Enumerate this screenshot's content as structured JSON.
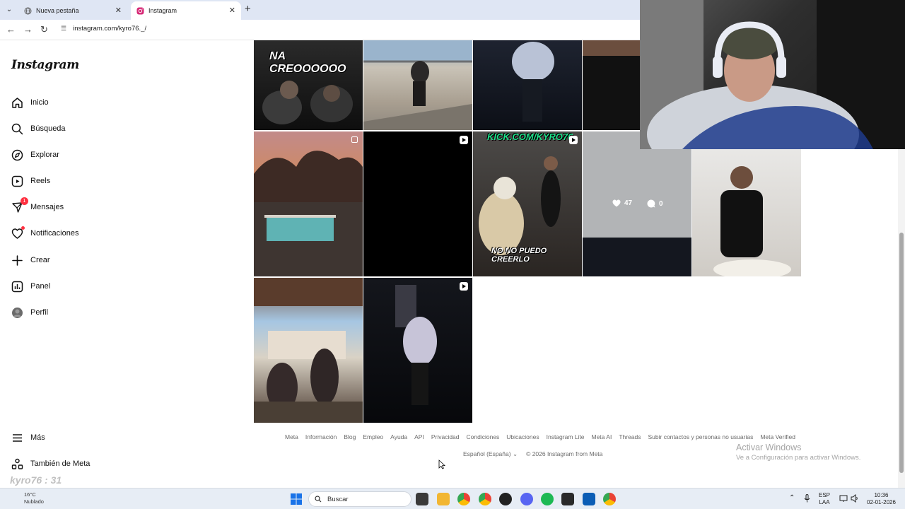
{
  "browser": {
    "tabs": [
      {
        "label": "Nueva pestaña",
        "active": false
      },
      {
        "label": "Instagram",
        "active": true
      }
    ],
    "address": "instagram.com/kyro76._/"
  },
  "sidebar": {
    "logo": "Instagram",
    "items": [
      {
        "label": "Inicio",
        "icon": "home-icon"
      },
      {
        "label": "Búsqueda",
        "icon": "search-icon"
      },
      {
        "label": "Explorar",
        "icon": "compass-icon"
      },
      {
        "label": "Reels",
        "icon": "reels-icon"
      },
      {
        "label": "Mensajes",
        "icon": "messenger-icon",
        "badge": "1"
      },
      {
        "label": "Notificaciones",
        "icon": "heart-icon"
      },
      {
        "label": "Crear",
        "icon": "plus-icon"
      },
      {
        "label": "Panel",
        "icon": "chart-icon"
      },
      {
        "label": "Perfil",
        "icon": "avatar-icon"
      }
    ],
    "more": "Más",
    "meta": "También de Meta"
  },
  "grid": {
    "captions": {
      "tile1": "NA CREOOOOOO",
      "tile7_top": "KICK.COM/KYRO76",
      "tile7_bottom": "NO NO PUEDO CREERLO"
    },
    "hover_stats": {
      "likes": "47",
      "comments": "0"
    }
  },
  "footer": {
    "links": [
      "Meta",
      "Información",
      "Blog",
      "Empleo",
      "Ayuda",
      "API",
      "Privacidad",
      "Condiciones",
      "Ubicaciones",
      "Instagram Lite",
      "Meta AI",
      "Threads",
      "Subir contactos y personas no usuarias",
      "Meta Verified"
    ],
    "language": "Español (España)",
    "copyright": "© 2026 Instagram from Meta"
  },
  "windows_watermark": {
    "title": "Activar Windows",
    "subtitle": "Ve a Configuración para activar Windows."
  },
  "taskbar": {
    "search": "Buscar",
    "lang_top": "ESP",
    "lang_bottom": "LAA",
    "time": "10:36",
    "date": "02-01-2026",
    "weather_temp": "16°C",
    "weather_text": "Nublado"
  },
  "stream_overlay": {
    "line1": "kyro76 : 31"
  },
  "colors": {
    "badge": "#ff3040",
    "tabbar": "#dfe6f4",
    "taskbar": "#e7edf5"
  }
}
